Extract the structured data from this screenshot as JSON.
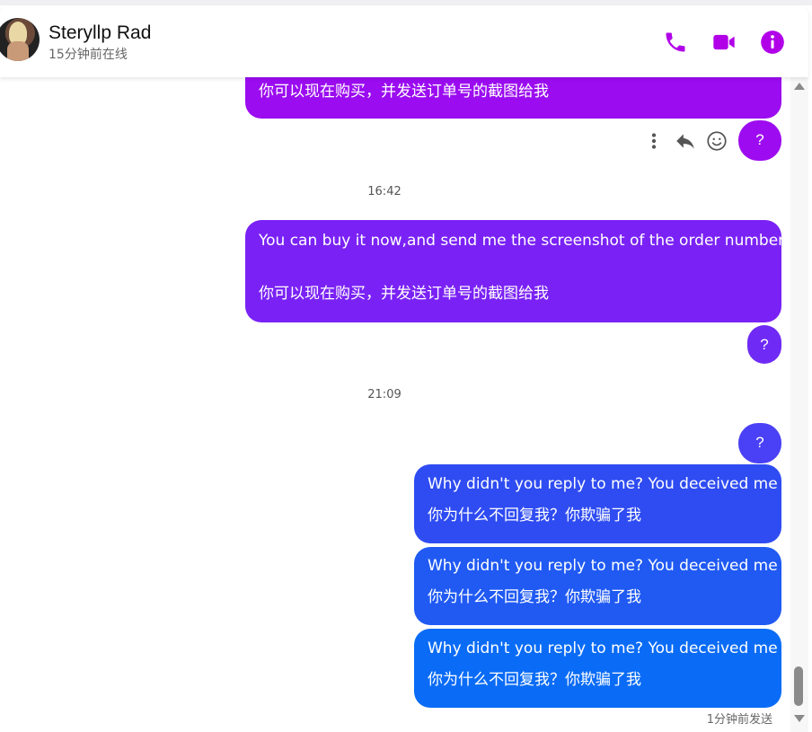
{
  "header": {
    "contact_name": "Steryllp Rad",
    "status": "15分钟前在线",
    "accent_color": "#b100e8",
    "icons": [
      "phone-icon",
      "video-call-icon",
      "info-icon"
    ]
  },
  "conversation": {
    "message_1": {
      "cn": "你可以现在购买，并发送订单号的截图给我"
    },
    "question_1": "?",
    "message_actions": [
      "more-options-icon",
      "reply-icon",
      "emoji-icon"
    ],
    "time_1": "16:42",
    "message_2": {
      "en": "You can buy it now,and send me the screenshot of the order number",
      "cn": "你可以现在购买，并发送订单号的截图给我"
    },
    "question_2": "?",
    "time_2": "21:09",
    "question_3": "?",
    "message_3": {
      "en": "Why didn't you reply to me? You deceived me",
      "cn": "你为什么不回复我？你欺骗了我"
    },
    "message_4": {
      "en": "Why didn't you reply to me? You deceived me",
      "cn": "你为什么不回复我？你欺骗了我"
    },
    "message_5": {
      "en": "Why didn't you reply to me? You deceived me",
      "cn": "你为什么不回复我？你欺骗了我"
    },
    "sent_status": "1分钟前发送"
  },
  "colors": {
    "bubble_top": "#9b0cf0",
    "bubble_mid": "#7a22f5",
    "bubble_blue": "#2f4cf2",
    "bubble_bottom": "#0a6cf6"
  }
}
